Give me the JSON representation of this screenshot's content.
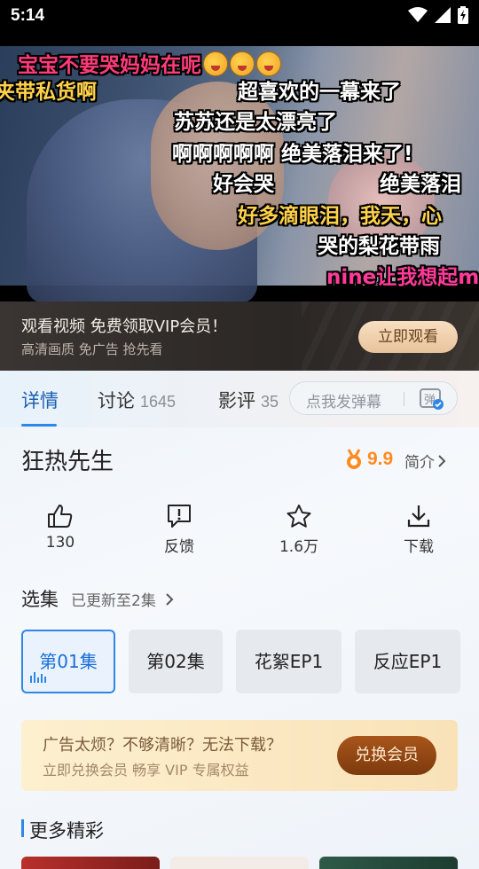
{
  "status": {
    "time": "5:14",
    "icons": [
      "wifi-icon",
      "signal-icon",
      "battery-icon"
    ]
  },
  "player": {
    "danmaku": [
      {
        "text": "宝宝不要哭妈妈在呢",
        "color": "#ff3b7a",
        "emoji_count": 3
      },
      {
        "text": "夹带私货啊",
        "color": "#ffd24a"
      },
      {
        "text": "超喜欢的一幕来了",
        "color": "#ffffff"
      },
      {
        "text": "苏苏还是太漂亮了",
        "color": "#ffffff"
      },
      {
        "text": "啊啊啊啊啊  绝美落泪来了!",
        "color": "#ffffff"
      },
      {
        "text": "好会哭",
        "color": "#ffffff"
      },
      {
        "text": "绝美落泪",
        "color": "#ffffff"
      },
      {
        "text": "好多滴眼泪，我天，心",
        "color": "#ffd24a"
      },
      {
        "text": "哭的梨花带雨",
        "color": "#ffffff"
      },
      {
        "text": "nine让我想起m",
        "color": "#ff3b9a"
      }
    ]
  },
  "vip_banner": {
    "title": "观看视频 免费领取VIP会员！",
    "subtitle": "高清画质 免广告 抢先看",
    "button": "立即观看"
  },
  "tabs": [
    {
      "label": "详情",
      "count": ""
    },
    {
      "label": "讨论",
      "count": "1645"
    },
    {
      "label": "影评",
      "count": "35"
    }
  ],
  "danmu_input": {
    "placeholder": "点我发弹幕",
    "icon": "danmaku-icon"
  },
  "show": {
    "title": "狂热先生",
    "rating": "9.9",
    "intro": "简介"
  },
  "actions": [
    {
      "label": "130",
      "icon": "thumbs-up-icon"
    },
    {
      "label": "反馈",
      "icon": "feedback-icon"
    },
    {
      "label": "1.6万",
      "icon": "star-icon"
    },
    {
      "label": "下载",
      "icon": "download-icon"
    }
  ],
  "episodes_section": {
    "title": "选集",
    "subtitle": "已更新至2集"
  },
  "episodes": [
    {
      "label": "第01集",
      "active": true
    },
    {
      "label": "第02集",
      "active": false
    },
    {
      "label": "花絮EP1",
      "active": false
    },
    {
      "label": "反应EP1",
      "active": false
    }
  ],
  "promo": {
    "title": "广告太烦？不够清晰？无法下载？",
    "subtitle": "立即兑换会员 畅享 VIP 专属权益",
    "button": "兑换会员"
  },
  "more": {
    "title": "更多精彩"
  },
  "colors": {
    "accent": "#2e86e6",
    "rating": "#ff8a1f",
    "vip_button": "#e8c39c",
    "promo_button": "#7d3a0d"
  }
}
